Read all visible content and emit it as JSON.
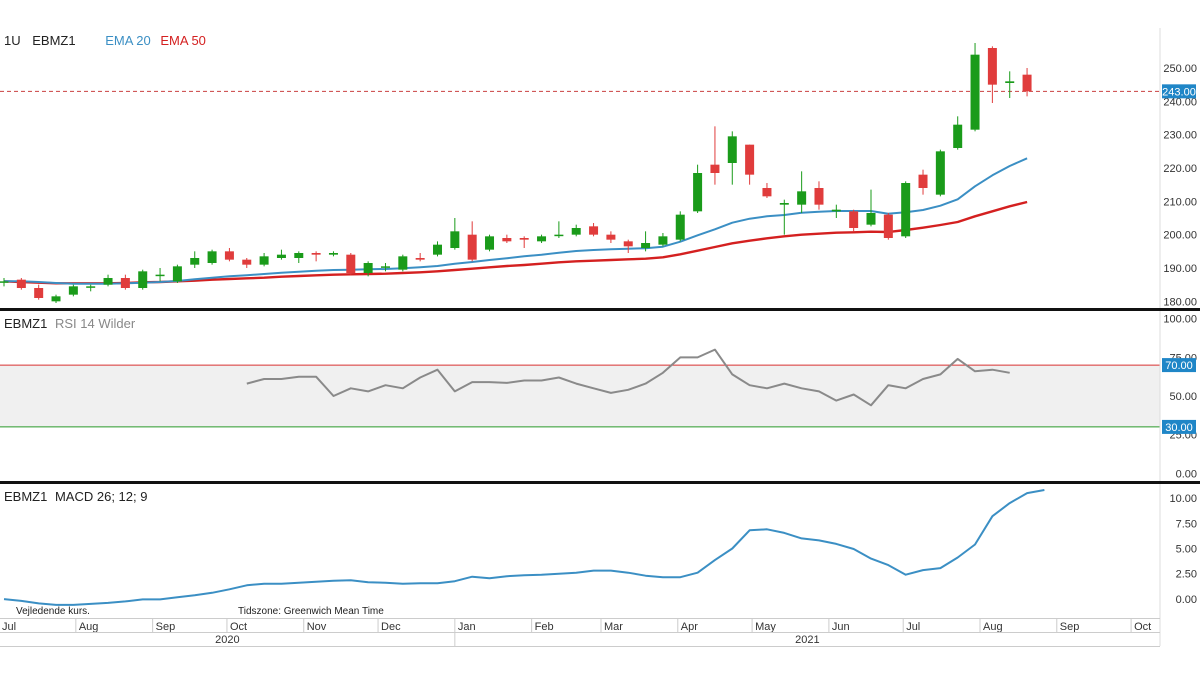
{
  "header": {
    "interval": "1U",
    "symbol": "EBMZ1",
    "ema20_label": "EMA 20",
    "ema50_label": "EMA 50"
  },
  "rsi_header": {
    "symbol": "EBMZ1",
    "label": "RSI 14 Wilder"
  },
  "macd_header": {
    "symbol": "EBMZ1",
    "label": "MACD 26; 12; 9"
  },
  "footer": {
    "note_left": "Vejledende kurs.",
    "timezone": "Tidszone: Greenwich Mean Time"
  },
  "colors": {
    "up": "#1a9b1a",
    "down": "#e03c3c",
    "ema20": "#3b8fc4",
    "ema50": "#d42020",
    "rsi": "#8a8a8a",
    "macd": "#3b8fc4",
    "rsi_band": "#f0f0f0",
    "rsi_upper": "#d93030",
    "rsi_lower": "#2a9a2a",
    "badge": "#1f86c7"
  },
  "chart_data": [
    {
      "type": "candlestick",
      "name": "price",
      "ylim": [
        178,
        262
      ],
      "yticks": [
        "180.00",
        "190.00",
        "200.00",
        "210.00",
        "220.00",
        "230.00",
        "240.00",
        "250.00"
      ],
      "yticks_values": [
        180,
        190,
        200,
        210,
        220,
        230,
        240,
        250
      ],
      "last_price": 243.0,
      "last_price_label": "243.00",
      "candles": [
        {
          "o": 186,
          "h": 187,
          "l": 184.5,
          "c": 186,
          "d": "2020-07-03"
        },
        {
          "o": 186.5,
          "h": 187,
          "l": 183.5,
          "c": 184,
          "d": "2020-07-10"
        },
        {
          "o": 184,
          "h": 185,
          "l": 180.5,
          "c": 181,
          "d": "2020-07-17"
        },
        {
          "o": 180,
          "h": 182,
          "l": 179.5,
          "c": 181.5,
          "d": "2020-07-24"
        },
        {
          "o": 182,
          "h": 185,
          "l": 181.5,
          "c": 184.5,
          "d": "2020-07-31"
        },
        {
          "o": 184.5,
          "h": 185,
          "l": 183,
          "c": 184.5,
          "d": "2020-08-07"
        },
        {
          "o": 185,
          "h": 188,
          "l": 184.5,
          "c": 187,
          "d": "2020-08-14"
        },
        {
          "o": 187,
          "h": 188,
          "l": 183.5,
          "c": 184,
          "d": "2020-08-21"
        },
        {
          "o": 184,
          "h": 189.5,
          "l": 183.5,
          "c": 189,
          "d": "2020-08-28"
        },
        {
          "o": 188,
          "h": 190,
          "l": 186,
          "c": 188,
          "d": "2020-09-04"
        },
        {
          "o": 186,
          "h": 191,
          "l": 185.5,
          "c": 190.5,
          "d": "2020-09-11"
        },
        {
          "o": 191,
          "h": 195,
          "l": 190,
          "c": 193,
          "d": "2020-09-18"
        },
        {
          "o": 191.5,
          "h": 195.5,
          "l": 191,
          "c": 195,
          "d": "2020-09-25"
        },
        {
          "o": 195,
          "h": 196,
          "l": 192,
          "c": 192.5,
          "d": "2020-10-02"
        },
        {
          "o": 192.5,
          "h": 193,
          "l": 190,
          "c": 191,
          "d": "2020-10-09"
        },
        {
          "o": 191,
          "h": 194.5,
          "l": 190.5,
          "c": 193.5,
          "d": "2020-10-16"
        },
        {
          "o": 193,
          "h": 195.5,
          "l": 192.5,
          "c": 194,
          "d": "2020-10-23"
        },
        {
          "o": 193,
          "h": 195,
          "l": 191.5,
          "c": 194.5,
          "d": "2020-10-30"
        },
        {
          "o": 194.5,
          "h": 195,
          "l": 192,
          "c": 194,
          "d": "2020-11-06"
        },
        {
          "o": 194,
          "h": 195,
          "l": 193.5,
          "c": 194.5,
          "d": "2020-11-13"
        },
        {
          "o": 194,
          "h": 194.5,
          "l": 188,
          "c": 188.5,
          "d": "2020-11-20"
        },
        {
          "o": 188.5,
          "h": 192,
          "l": 187.5,
          "c": 191.5,
          "d": "2020-11-27"
        },
        {
          "o": 190.5,
          "h": 191.5,
          "l": 189,
          "c": 190.5,
          "d": "2020-12-04"
        },
        {
          "o": 189.5,
          "h": 194,
          "l": 189,
          "c": 193.5,
          "d": "2020-12-11"
        },
        {
          "o": 193,
          "h": 194.5,
          "l": 192,
          "c": 192.5,
          "d": "2020-12-18"
        },
        {
          "o": 194,
          "h": 198,
          "l": 193.5,
          "c": 197,
          "d": "2020-12-25"
        },
        {
          "o": 196,
          "h": 205,
          "l": 195.5,
          "c": 201,
          "d": "2021-01-01"
        },
        {
          "o": 200,
          "h": 204,
          "l": 192,
          "c": 192.5,
          "d": "2021-01-08"
        },
        {
          "o": 195.5,
          "h": 200,
          "l": 195,
          "c": 199.5,
          "d": "2021-01-15"
        },
        {
          "o": 199,
          "h": 200,
          "l": 197.5,
          "c": 198,
          "d": "2021-01-22"
        },
        {
          "o": 199,
          "h": 199.5,
          "l": 196,
          "c": 198.5,
          "d": "2021-01-29"
        },
        {
          "o": 198,
          "h": 200,
          "l": 197.5,
          "c": 199.5,
          "d": "2021-02-05"
        },
        {
          "o": 200,
          "h": 204,
          "l": 199,
          "c": 200,
          "d": "2021-02-12"
        },
        {
          "o": 200,
          "h": 203,
          "l": 199.5,
          "c": 202,
          "d": "2021-02-19"
        },
        {
          "o": 202.5,
          "h": 203.5,
          "l": 199.5,
          "c": 200,
          "d": "2021-02-26"
        },
        {
          "o": 200,
          "h": 201,
          "l": 197.5,
          "c": 198.5,
          "d": "2021-03-05"
        },
        {
          "o": 198,
          "h": 198.5,
          "l": 194.5,
          "c": 196.5,
          "d": "2021-03-12"
        },
        {
          "o": 196,
          "h": 201,
          "l": 195,
          "c": 197.5,
          "d": "2021-03-19"
        },
        {
          "o": 197,
          "h": 200.5,
          "l": 196.5,
          "c": 199.5,
          "d": "2021-03-26"
        },
        {
          "o": 198.5,
          "h": 207,
          "l": 198,
          "c": 206,
          "d": "2021-04-02"
        },
        {
          "o": 207,
          "h": 221,
          "l": 206.5,
          "c": 218.5,
          "d": "2021-04-09"
        },
        {
          "o": 221,
          "h": 232.5,
          "l": 215,
          "c": 218.5,
          "d": "2021-04-16"
        },
        {
          "o": 221.5,
          "h": 231,
          "l": 215,
          "c": 229.5,
          "d": "2021-04-23"
        },
        {
          "o": 227,
          "h": 227,
          "l": 215,
          "c": 218,
          "d": "2021-04-30"
        },
        {
          "o": 214,
          "h": 215.5,
          "l": 211,
          "c": 211.5,
          "d": "2021-05-07"
        },
        {
          "o": 209,
          "h": 210.5,
          "l": 200,
          "c": 209.5,
          "d": "2021-05-14"
        },
        {
          "o": 209,
          "h": 219,
          "l": 206.5,
          "c": 213,
          "d": "2021-05-21"
        },
        {
          "o": 214,
          "h": 216,
          "l": 207.5,
          "c": 209,
          "d": "2021-05-28"
        },
        {
          "o": 207,
          "h": 209,
          "l": 205,
          "c": 207.5,
          "d": "2021-06-04"
        },
        {
          "o": 207,
          "h": 207.5,
          "l": 201,
          "c": 202,
          "d": "2021-06-11"
        },
        {
          "o": 203,
          "h": 213.5,
          "l": 202.5,
          "c": 206.5,
          "d": "2021-06-18"
        },
        {
          "o": 206,
          "h": 206.5,
          "l": 198.5,
          "c": 199,
          "d": "2021-06-25"
        },
        {
          "o": 199.5,
          "h": 216,
          "l": 199,
          "c": 215.5,
          "d": "2021-07-02"
        },
        {
          "o": 218,
          "h": 219.5,
          "l": 212,
          "c": 214,
          "d": "2021-07-09"
        },
        {
          "o": 212,
          "h": 225.5,
          "l": 211.5,
          "c": 225,
          "d": "2021-07-16"
        },
        {
          "o": 226,
          "h": 235.5,
          "l": 225.5,
          "c": 233,
          "d": "2021-07-23"
        },
        {
          "o": 231.5,
          "h": 257.5,
          "l": 231,
          "c": 254,
          "d": "2021-07-30"
        },
        {
          "o": 256,
          "h": 256.5,
          "l": 239.5,
          "c": 245,
          "d": "2021-08-06"
        },
        {
          "o": 245.5,
          "h": 249,
          "l": 241,
          "c": 246,
          "d": "2021-08-13"
        },
        {
          "o": 248,
          "h": 250,
          "l": 241.5,
          "c": 243,
          "d": "2021-08-20"
        }
      ],
      "ema20": [
        186,
        186,
        185.8,
        185.5,
        185.3,
        185.3,
        185.3,
        185.4,
        185.6,
        185.8,
        186.1,
        186.6,
        187.1,
        187.5,
        187.8,
        188.2,
        188.6,
        188.9,
        189.2,
        189.4,
        189.5,
        189.6,
        189.7,
        189.9,
        190.2,
        190.6,
        191.3,
        191.8,
        192.4,
        192.9,
        193.5,
        194,
        194.6,
        195.1,
        195.4,
        195.6,
        195.8,
        195.9,
        196.4,
        197.9,
        199.8,
        201.6,
        203.6,
        204.8,
        205.5,
        205.9,
        206.6,
        206.9,
        207.1,
        207.1,
        207.1,
        206.3,
        206.7,
        207.4,
        208.7,
        210.6,
        214.5,
        217.8,
        220.6,
        222.9
      ],
      "ema50": [
        186,
        185.8,
        185.6,
        185.4,
        185.4,
        185.4,
        185.4,
        185.5,
        185.7,
        185.8,
        186,
        186.2,
        186.5,
        186.7,
        186.9,
        187.1,
        187.4,
        187.6,
        187.8,
        188,
        188.1,
        188.2,
        188.3,
        188.5,
        188.7,
        189,
        189.4,
        189.8,
        190.2,
        190.6,
        190.9,
        191.3,
        191.7,
        192,
        192.2,
        192.4,
        192.6,
        192.8,
        193.2,
        194.1,
        195.2,
        196.3,
        197.4,
        198.2,
        198.9,
        199.5,
        200,
        200.3,
        200.6,
        200.7,
        200.9,
        200.8,
        201.4,
        202.1,
        202.9,
        203.8,
        205.5,
        207,
        208.5,
        209.8
      ]
    },
    {
      "type": "line",
      "name": "RSI 14 Wilder",
      "ylim": [
        -5,
        105
      ],
      "yticks": [
        "0.00",
        "25.00",
        "50.00",
        "75.00",
        "100.00"
      ],
      "yticks_values": [
        0,
        25,
        50,
        75,
        100
      ],
      "upper": 70,
      "lower": 30,
      "upper_label": "70.00",
      "lower_label": "30.00",
      "start_index": 14,
      "values": [
        58,
        61,
        61,
        62.5,
        62.5,
        50,
        55,
        53,
        57,
        55,
        62,
        67,
        53,
        59,
        59,
        58.5,
        60,
        60,
        62,
        58,
        55,
        52,
        54,
        58,
        65,
        75,
        75,
        80,
        64,
        57,
        55,
        58,
        55,
        53,
        47,
        51,
        44,
        57,
        55,
        61,
        64,
        74,
        66,
        67,
        65
      ]
    },
    {
      "type": "line",
      "name": "MACD 26; 12; 9",
      "ylim": [
        -1.9,
        11.4
      ],
      "yticks": [
        "0.00",
        "2.50",
        "5.00",
        "7.50",
        "10.00"
      ],
      "yticks_values": [
        0,
        2.5,
        5,
        7.5,
        10
      ],
      "values": [
        -0.02,
        -0.2,
        -0.45,
        -0.6,
        -0.6,
        -0.5,
        -0.4,
        -0.25,
        -0.05,
        -0.05,
        0.15,
        0.35,
        0.6,
        0.95,
        1.35,
        1.5,
        1.5,
        1.6,
        1.7,
        1.8,
        1.85,
        1.65,
        1.6,
        1.5,
        1.55,
        1.55,
        1.75,
        2.2,
        2.05,
        2.25,
        2.35,
        2.4,
        2.5,
        2.6,
        2.8,
        2.8,
        2.6,
        2.3,
        2.15,
        2.15,
        2.6,
        3.85,
        5.0,
        6.8,
        6.9,
        6.55,
        6.0,
        5.8,
        5.45,
        4.95,
        4.0,
        3.35,
        2.4,
        2.85,
        3.05,
        4.1,
        5.4,
        8.2,
        9.5,
        10.5,
        10.8
      ]
    }
  ],
  "x_axis": {
    "months": [
      {
        "label": "Jul",
        "d": "2020-07-01"
      },
      {
        "label": "Aug",
        "d": "2020-08-01"
      },
      {
        "label": "Sep",
        "d": "2020-09-01"
      },
      {
        "label": "Oct",
        "d": "2020-10-01"
      },
      {
        "label": "Nov",
        "d": "2020-11-01"
      },
      {
        "label": "Dec",
        "d": "2020-12-01"
      },
      {
        "label": "Jan",
        "d": "2021-01-01"
      },
      {
        "label": "Feb",
        "d": "2021-02-01"
      },
      {
        "label": "Mar",
        "d": "2021-03-01"
      },
      {
        "label": "Apr",
        "d": "2021-04-01"
      },
      {
        "label": "May",
        "d": "2021-05-01"
      },
      {
        "label": "Jun",
        "d": "2021-06-01"
      },
      {
        "label": "Jul",
        "d": "2021-07-01"
      },
      {
        "label": "Aug",
        "d": "2021-08-01"
      },
      {
        "label": "Sep",
        "d": "2021-09-01"
      },
      {
        "label": "Oct",
        "d": "2021-10-01"
      }
    ],
    "years": [
      {
        "label": "2020",
        "d": "2020-07-01"
      },
      {
        "label": "2021",
        "d": "2021-01-01"
      }
    ]
  }
}
